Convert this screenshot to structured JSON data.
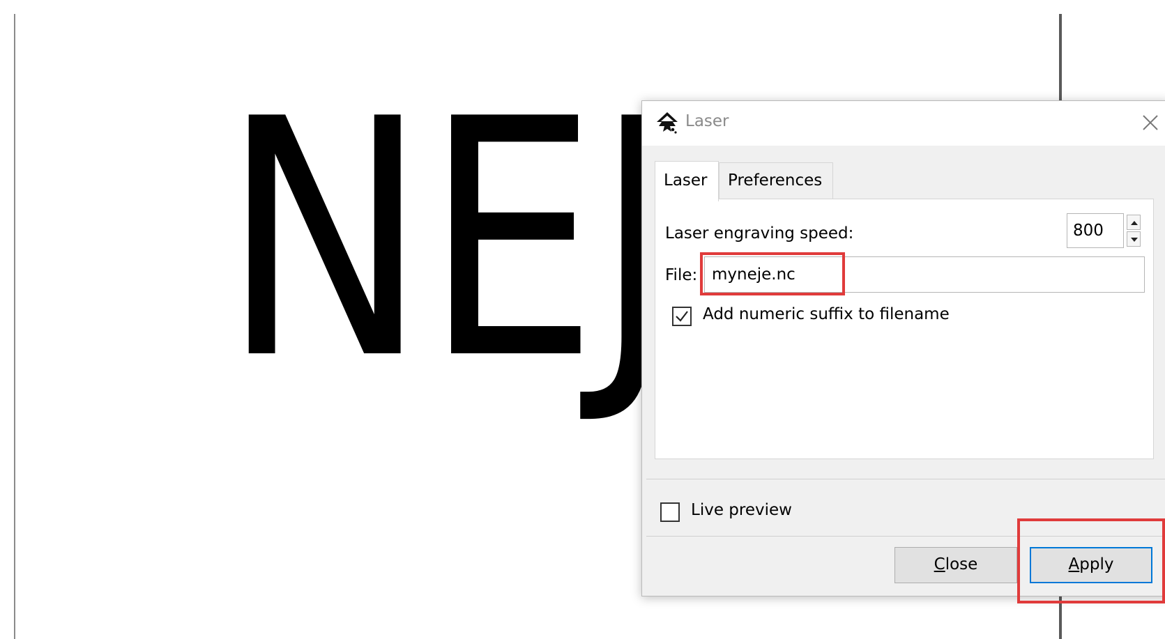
{
  "canvas": {
    "text": "NEJE"
  },
  "dialog": {
    "title": "Laser",
    "app_icon": "inkscape-icon",
    "close_icon": "close-icon",
    "tabs": [
      {
        "label": "Laser",
        "active": true
      },
      {
        "label": "Preferences",
        "active": false
      }
    ],
    "speed": {
      "label": "Laser engraving speed:",
      "value": "800"
    },
    "file": {
      "label": "File:",
      "value": "myneje.nc"
    },
    "suffix": {
      "label": "Add numeric suffix to filename",
      "checked": true
    },
    "live_preview": {
      "label": "Live preview",
      "checked": false
    },
    "buttons": {
      "close_mnemonic": "C",
      "close_rest": "lose",
      "apply_mnemonic": "A",
      "apply_rest": "pply"
    },
    "highlight_color": "#e03b3b",
    "focus_color": "#0078d7"
  }
}
